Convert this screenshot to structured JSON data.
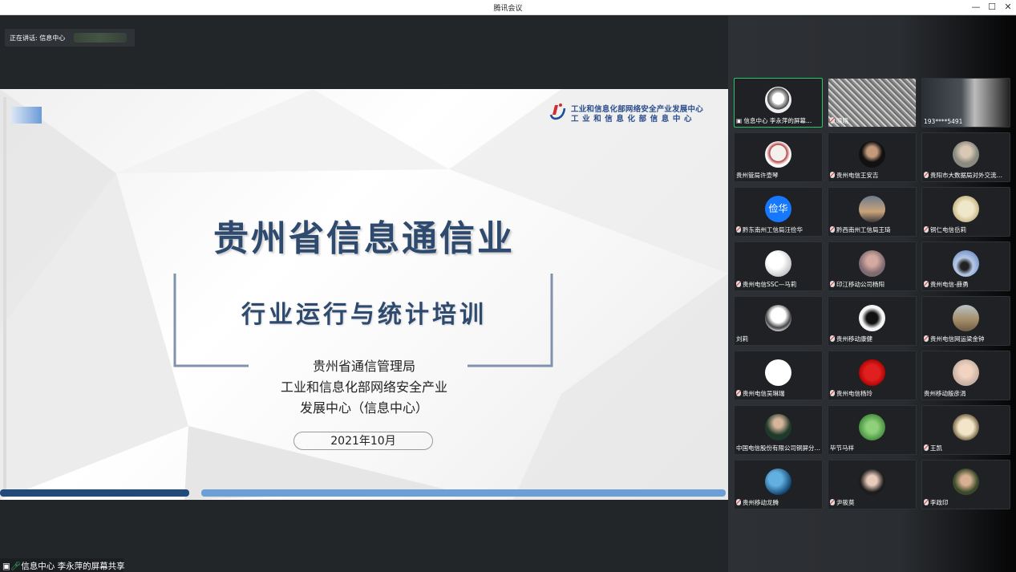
{
  "window": {
    "title": "腾讯会议",
    "minimize_icon": "—",
    "maximize_icon": "☐",
    "close_icon": "✕"
  },
  "speaking": {
    "label": "正在讲话: 信息中心"
  },
  "slide": {
    "logo_line1": "工业和信息化部网络安全产业发展中心",
    "logo_line2": "工业和信息化部信息中心",
    "title": "贵州省信息通信业",
    "subtitle": "行业运行与统计培训",
    "org_line1": "贵州省通信管理局",
    "org_line2": "工业和信息化部网络安全产业",
    "org_line3": "发展中心（信息中心）",
    "date": "2021年10月"
  },
  "share_status": {
    "label": "信息中心 李永萍的屏幕共享"
  },
  "participants": [
    {
      "name": "信息中心 李永萍的屏幕…",
      "avatar": "anime-girl",
      "muted": false,
      "sharing": true
    },
    {
      "name": "晓晓",
      "avatar": "video-texture",
      "muted": true
    },
    {
      "name": "193****5491",
      "avatar": "video-person",
      "muted": false
    },
    {
      "name": "贵州管局许壶琴",
      "avatar": "bear",
      "muted": false
    },
    {
      "name": "贵州电信王安吉",
      "avatar": "person-dark",
      "muted": true
    },
    {
      "name": "贵阳市大数据局对外交流…",
      "avatar": "person-gray",
      "muted": true
    },
    {
      "name": "黔东南州工信局汪俭华",
      "avatar": "text",
      "avatar_text": "俭华",
      "muted": true
    },
    {
      "name": "黔西南州工信局王琦",
      "avatar": "landscape",
      "muted": true
    },
    {
      "name": "铜仁电信岳莉",
      "avatar": "sketch",
      "muted": true
    },
    {
      "name": "贵州电信SSC—马莉",
      "avatar": "white-flower",
      "muted": true
    },
    {
      "name": "印江移动公司杨阳",
      "avatar": "person-pink",
      "muted": true
    },
    {
      "name": "贵州电信-薛勇",
      "avatar": "sky",
      "muted": true
    },
    {
      "name": "刘莉",
      "avatar": "mushroom",
      "muted": false
    },
    {
      "name": "贵州移动康健",
      "avatar": "mono-figure",
      "muted": true
    },
    {
      "name": "贵州电信网运梁金钟",
      "avatar": "road",
      "muted": true
    },
    {
      "name": "贵州电信吴琳瑞",
      "avatar": "white",
      "muted": true
    },
    {
      "name": "贵州电信杨玲",
      "avatar": "red-rose",
      "muted": true
    },
    {
      "name": "贵州移动殷彦涓",
      "avatar": "child",
      "muted": false
    },
    {
      "name": "中国电信股份有限公司铜屏分…",
      "avatar": "man-suit",
      "muted": false
    },
    {
      "name": "毕节马祥",
      "avatar": "green-leaf",
      "muted": false
    },
    {
      "name": "王凯",
      "avatar": "cartoon",
      "muted": true
    },
    {
      "name": "贵州移动龙腾",
      "avatar": "ocean",
      "muted": true
    },
    {
      "name": "尹筱莫",
      "avatar": "woman",
      "muted": true
    },
    {
      "name": "李政印",
      "avatar": "cap-man",
      "muted": true
    }
  ],
  "colors": {
    "accent_green": "#2ec36b",
    "slide_title": "#2e4a6e",
    "bar_dark": "#1f4a7a",
    "bar_light": "#6b9fd6"
  }
}
